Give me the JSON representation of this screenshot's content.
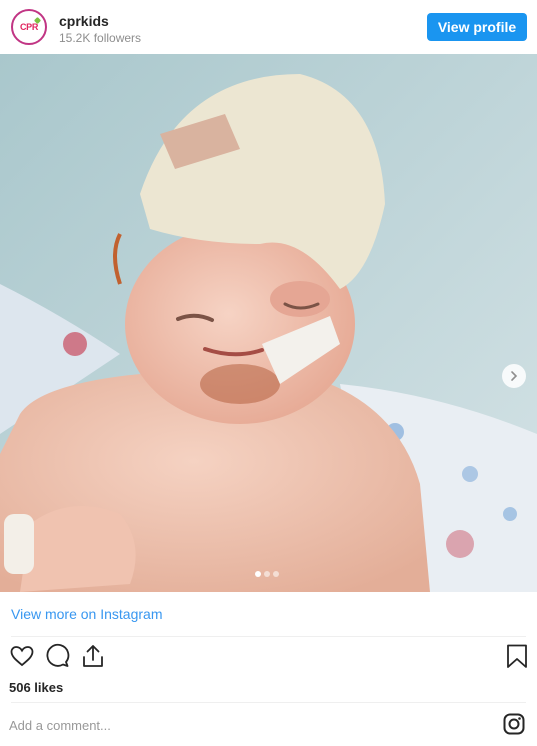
{
  "header": {
    "avatar_icon": "cpr-kids-logo",
    "avatar_logo_text": "CPR",
    "username": "cprkids",
    "followers": "15.2K followers",
    "view_profile_label": "View profile"
  },
  "post": {
    "image_alt": "Toddler with bandaged head in hospital bed",
    "carousel": {
      "total": 3,
      "active_index": 0
    },
    "next_icon": "chevron-right-icon",
    "view_more_label": "View more on Instagram",
    "actions": {
      "like_icon": "heart-icon",
      "comment_icon": "comment-icon",
      "share_icon": "share-icon",
      "save_icon": "bookmark-icon"
    },
    "likes": "506 likes"
  },
  "comment": {
    "placeholder": "Add a comment...",
    "instagram_icon": "instagram-icon"
  },
  "colors": {
    "accent": "#1a95f0",
    "link": "#3897f0"
  }
}
